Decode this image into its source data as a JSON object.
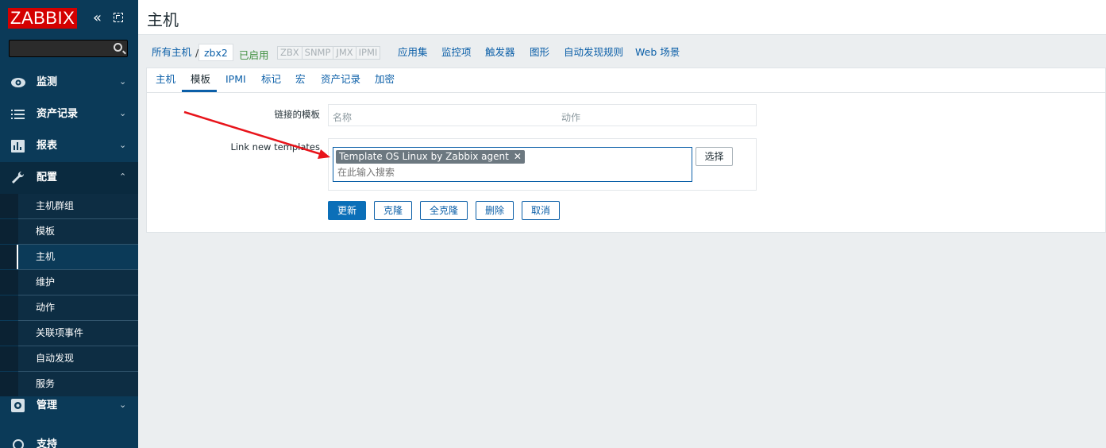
{
  "brand": {
    "logo_text": "ZABBIX",
    "logo_color": "#d40000"
  },
  "sidebar": {
    "collapse_glyph": "«",
    "menu": [
      {
        "label": "监测",
        "icon": "eye-icon"
      },
      {
        "label": "资产记录",
        "icon": "list-icon"
      },
      {
        "label": "报表",
        "icon": "bar-chart-icon"
      },
      {
        "label": "配置",
        "icon": "wrench-icon"
      },
      {
        "label": "管理",
        "icon": "gear-icon"
      },
      {
        "label": "支持",
        "icon": "support-icon"
      }
    ],
    "submenu": [
      {
        "label": "主机群组"
      },
      {
        "label": "模板"
      },
      {
        "label": "主机"
      },
      {
        "label": "维护"
      },
      {
        "label": "动作"
      },
      {
        "label": "关联项事件"
      },
      {
        "label": "自动发现"
      },
      {
        "label": "服务"
      }
    ]
  },
  "page": {
    "title": "主机"
  },
  "host_nav": {
    "all_hosts": "所有主机",
    "separator": "/",
    "host_name": "zbx2",
    "status": "已启用",
    "availability": [
      "ZBX",
      "SNMP",
      "JMX",
      "IPMI"
    ],
    "links": [
      "应用集",
      "监控项",
      "触发器",
      "图形",
      "自动发现规则",
      "Web 场景"
    ]
  },
  "tabs": [
    "主机",
    "模板",
    "IPMI",
    "标记",
    "宏",
    "资产记录",
    "加密"
  ],
  "form": {
    "linked_label": "链接的模板",
    "linked_cols": [
      "名称",
      "动作"
    ],
    "link_new_label": "Link new templates",
    "selected_tag": "Template OS Linux by Zabbix agent",
    "tag_remove": "✕",
    "search_placeholder": "在此输入搜索",
    "select_button": "选择"
  },
  "buttons": [
    "更新",
    "克隆",
    "全克隆",
    "删除",
    "取消"
  ],
  "colors": {
    "sidebar": "#0b3a58",
    "link": "#0b5fa8",
    "primary": "#0b6fb8",
    "arrow": "#e8141b"
  }
}
